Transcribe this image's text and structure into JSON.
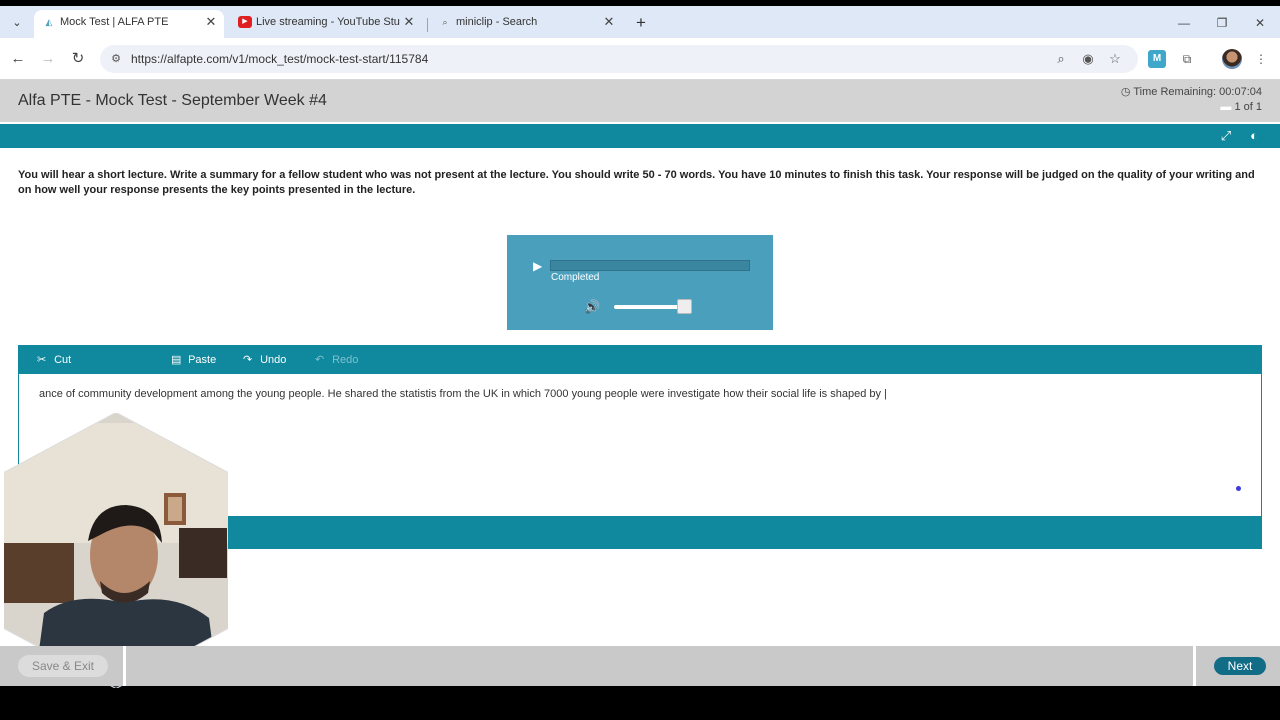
{
  "browser": {
    "tabs": [
      {
        "title": "Mock Test | ALFA PTE",
        "favicon": "alfa",
        "active": true
      },
      {
        "title": "Live streaming - YouTube Studio",
        "favicon": "youtube",
        "active": false
      },
      {
        "title": "miniclip - Search",
        "favicon": "search",
        "active": false
      }
    ],
    "url": "https://alfapte.com/v1/mock_test/mock-test-start/115784",
    "favicon_alfa": "alfa"
  },
  "header": {
    "title": "Alfa PTE - Mock Test - September Week #4",
    "time_label": "Time Remaining:",
    "time_value": "00:07:04",
    "page_counter": "1 of 1"
  },
  "instruction": "You will hear a short lecture. Write a summary for a fellow student who was not present at the lecture. You should write 50 - 70 words. You have 10 minutes to finish this task. Your response will be judged on the quality of your writing and on how well your response presents the key points presented in the lecture.",
  "player": {
    "status": "Completed",
    "volume_level": 0.8
  },
  "editor": {
    "toolbar": {
      "cut": "Cut",
      "paste": "Paste",
      "undo": "Undo",
      "redo": "Redo"
    },
    "text": "ance of community development among the young people. He shared the statistis from the UK in which 7000 young people were investigate how their social life is shaped by |"
  },
  "footer": {
    "save_exit": "Save & Exit",
    "next": "Next"
  },
  "colors": {
    "teal": "#10889d",
    "player": "#4a9fbd",
    "next_button": "#116c86"
  }
}
